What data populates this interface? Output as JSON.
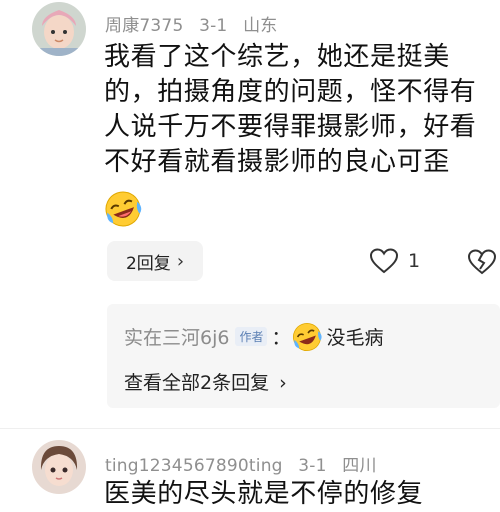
{
  "comment1": {
    "username": "周康7375",
    "date": "3-1",
    "location": "山东",
    "lines": [
      "我看了这个综艺，她还是挺美",
      "的，拍摄角度的问题，怪不得有",
      "人说千万不要得罪摄影师，好看",
      "不好看就看摄影师的良心可歪"
    ],
    "emoji": "laughing-crying-emoji",
    "replies_button": "2回复",
    "like_count": "1",
    "reply": {
      "username": "实在三河6j6",
      "author_tag": "作者",
      "colon": "：",
      "text": "没毛病",
      "view_all": "查看全部2条回复"
    }
  },
  "comment2": {
    "username": "ting1234567890ting",
    "date": "3-1",
    "location": "四川",
    "text_partial": "医美的尽头就是不停的修复"
  },
  "colors": {
    "meta": "#8f8f8f",
    "author_tag": "#5b7fb3"
  }
}
